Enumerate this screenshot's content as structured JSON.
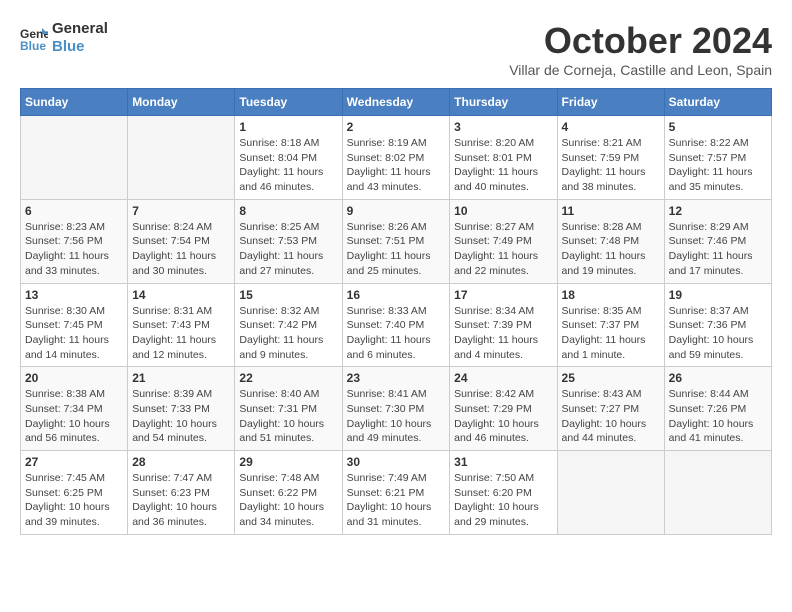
{
  "header": {
    "logo_line1": "General",
    "logo_line2": "Blue",
    "month": "October 2024",
    "location": "Villar de Corneja, Castille and Leon, Spain"
  },
  "weekdays": [
    "Sunday",
    "Monday",
    "Tuesday",
    "Wednesday",
    "Thursday",
    "Friday",
    "Saturday"
  ],
  "weeks": [
    [
      {
        "day": "",
        "info": ""
      },
      {
        "day": "",
        "info": ""
      },
      {
        "day": "1",
        "info": "Sunrise: 8:18 AM\nSunset: 8:04 PM\nDaylight: 11 hours and 46 minutes."
      },
      {
        "day": "2",
        "info": "Sunrise: 8:19 AM\nSunset: 8:02 PM\nDaylight: 11 hours and 43 minutes."
      },
      {
        "day": "3",
        "info": "Sunrise: 8:20 AM\nSunset: 8:01 PM\nDaylight: 11 hours and 40 minutes."
      },
      {
        "day": "4",
        "info": "Sunrise: 8:21 AM\nSunset: 7:59 PM\nDaylight: 11 hours and 38 minutes."
      },
      {
        "day": "5",
        "info": "Sunrise: 8:22 AM\nSunset: 7:57 PM\nDaylight: 11 hours and 35 minutes."
      }
    ],
    [
      {
        "day": "6",
        "info": "Sunrise: 8:23 AM\nSunset: 7:56 PM\nDaylight: 11 hours and 33 minutes."
      },
      {
        "day": "7",
        "info": "Sunrise: 8:24 AM\nSunset: 7:54 PM\nDaylight: 11 hours and 30 minutes."
      },
      {
        "day": "8",
        "info": "Sunrise: 8:25 AM\nSunset: 7:53 PM\nDaylight: 11 hours and 27 minutes."
      },
      {
        "day": "9",
        "info": "Sunrise: 8:26 AM\nSunset: 7:51 PM\nDaylight: 11 hours and 25 minutes."
      },
      {
        "day": "10",
        "info": "Sunrise: 8:27 AM\nSunset: 7:49 PM\nDaylight: 11 hours and 22 minutes."
      },
      {
        "day": "11",
        "info": "Sunrise: 8:28 AM\nSunset: 7:48 PM\nDaylight: 11 hours and 19 minutes."
      },
      {
        "day": "12",
        "info": "Sunrise: 8:29 AM\nSunset: 7:46 PM\nDaylight: 11 hours and 17 minutes."
      }
    ],
    [
      {
        "day": "13",
        "info": "Sunrise: 8:30 AM\nSunset: 7:45 PM\nDaylight: 11 hours and 14 minutes."
      },
      {
        "day": "14",
        "info": "Sunrise: 8:31 AM\nSunset: 7:43 PM\nDaylight: 11 hours and 12 minutes."
      },
      {
        "day": "15",
        "info": "Sunrise: 8:32 AM\nSunset: 7:42 PM\nDaylight: 11 hours and 9 minutes."
      },
      {
        "day": "16",
        "info": "Sunrise: 8:33 AM\nSunset: 7:40 PM\nDaylight: 11 hours and 6 minutes."
      },
      {
        "day": "17",
        "info": "Sunrise: 8:34 AM\nSunset: 7:39 PM\nDaylight: 11 hours and 4 minutes."
      },
      {
        "day": "18",
        "info": "Sunrise: 8:35 AM\nSunset: 7:37 PM\nDaylight: 11 hours and 1 minute."
      },
      {
        "day": "19",
        "info": "Sunrise: 8:37 AM\nSunset: 7:36 PM\nDaylight: 10 hours and 59 minutes."
      }
    ],
    [
      {
        "day": "20",
        "info": "Sunrise: 8:38 AM\nSunset: 7:34 PM\nDaylight: 10 hours and 56 minutes."
      },
      {
        "day": "21",
        "info": "Sunrise: 8:39 AM\nSunset: 7:33 PM\nDaylight: 10 hours and 54 minutes."
      },
      {
        "day": "22",
        "info": "Sunrise: 8:40 AM\nSunset: 7:31 PM\nDaylight: 10 hours and 51 minutes."
      },
      {
        "day": "23",
        "info": "Sunrise: 8:41 AM\nSunset: 7:30 PM\nDaylight: 10 hours and 49 minutes."
      },
      {
        "day": "24",
        "info": "Sunrise: 8:42 AM\nSunset: 7:29 PM\nDaylight: 10 hours and 46 minutes."
      },
      {
        "day": "25",
        "info": "Sunrise: 8:43 AM\nSunset: 7:27 PM\nDaylight: 10 hours and 44 minutes."
      },
      {
        "day": "26",
        "info": "Sunrise: 8:44 AM\nSunset: 7:26 PM\nDaylight: 10 hours and 41 minutes."
      }
    ],
    [
      {
        "day": "27",
        "info": "Sunrise: 7:45 AM\nSunset: 6:25 PM\nDaylight: 10 hours and 39 minutes."
      },
      {
        "day": "28",
        "info": "Sunrise: 7:47 AM\nSunset: 6:23 PM\nDaylight: 10 hours and 36 minutes."
      },
      {
        "day": "29",
        "info": "Sunrise: 7:48 AM\nSunset: 6:22 PM\nDaylight: 10 hours and 34 minutes."
      },
      {
        "day": "30",
        "info": "Sunrise: 7:49 AM\nSunset: 6:21 PM\nDaylight: 10 hours and 31 minutes."
      },
      {
        "day": "31",
        "info": "Sunrise: 7:50 AM\nSunset: 6:20 PM\nDaylight: 10 hours and 29 minutes."
      },
      {
        "day": "",
        "info": ""
      },
      {
        "day": "",
        "info": ""
      }
    ]
  ]
}
